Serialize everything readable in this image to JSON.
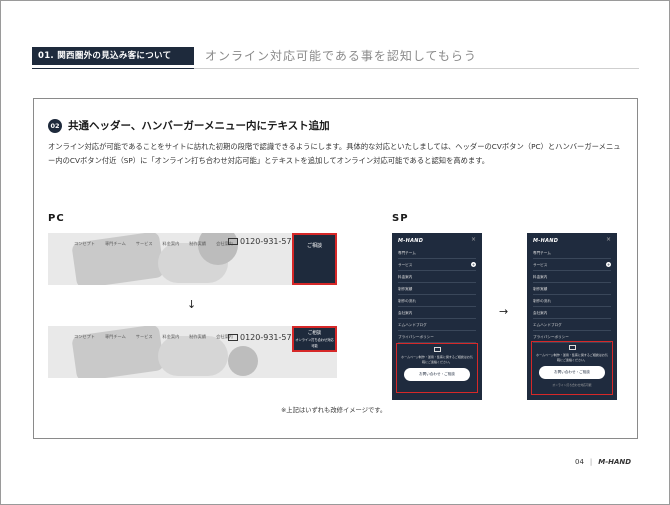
{
  "header": {
    "section_tag": "01. 関西圏外の見込み客について",
    "section_title": "オンライン対応可能である事を認知してもらう"
  },
  "box": {
    "badge": "02",
    "heading": "共通ヘッダー、ハンバーガーメニュー内にテキスト追加",
    "paragraph": "オンライン対応が可能であることをサイトに訪れた初期の段階で認識できるようにします。具体的な対応といたしましては、ヘッダーのCVボタン（PC）とハンバーガーメニュー内のCVボタン付近（SP）に「オンライン打ち合わせ対応可能」とテキストを追加してオンライン対応可能であると認知を高めます。"
  },
  "pc": {
    "label": "PC",
    "nav": [
      "コンセプト",
      "専門チーム",
      "サービス",
      "料金案内",
      "制作実績",
      "会社案内"
    ],
    "tel": "0120-931-572",
    "cv_before": "ご相談",
    "cv_after": "ご相談",
    "cv_after_sub": "オンライン打ち合わせ対応可能",
    "arrow": "↓"
  },
  "sp": {
    "label": "SP",
    "logo": "M-HAND",
    "close": "×",
    "menu": [
      "専門チーム",
      "サービス",
      "料金案内",
      "制作実績",
      "制作の流れ",
      "会社案内",
      "エムハンドブログ",
      "プライバシーポリシー"
    ],
    "box_text": "ホームページ制作・運用・集客に関するご相談はお気軽にご連絡ください。",
    "button": "お問い合わせ・ご相談",
    "sub_after": "オンライン打ち合わせ対応可能",
    "arrow": "→"
  },
  "note": "※上記はいずれも改修イメージです。",
  "footer": {
    "page": "04",
    "sep": "|",
    "brand": "M-HAND"
  }
}
